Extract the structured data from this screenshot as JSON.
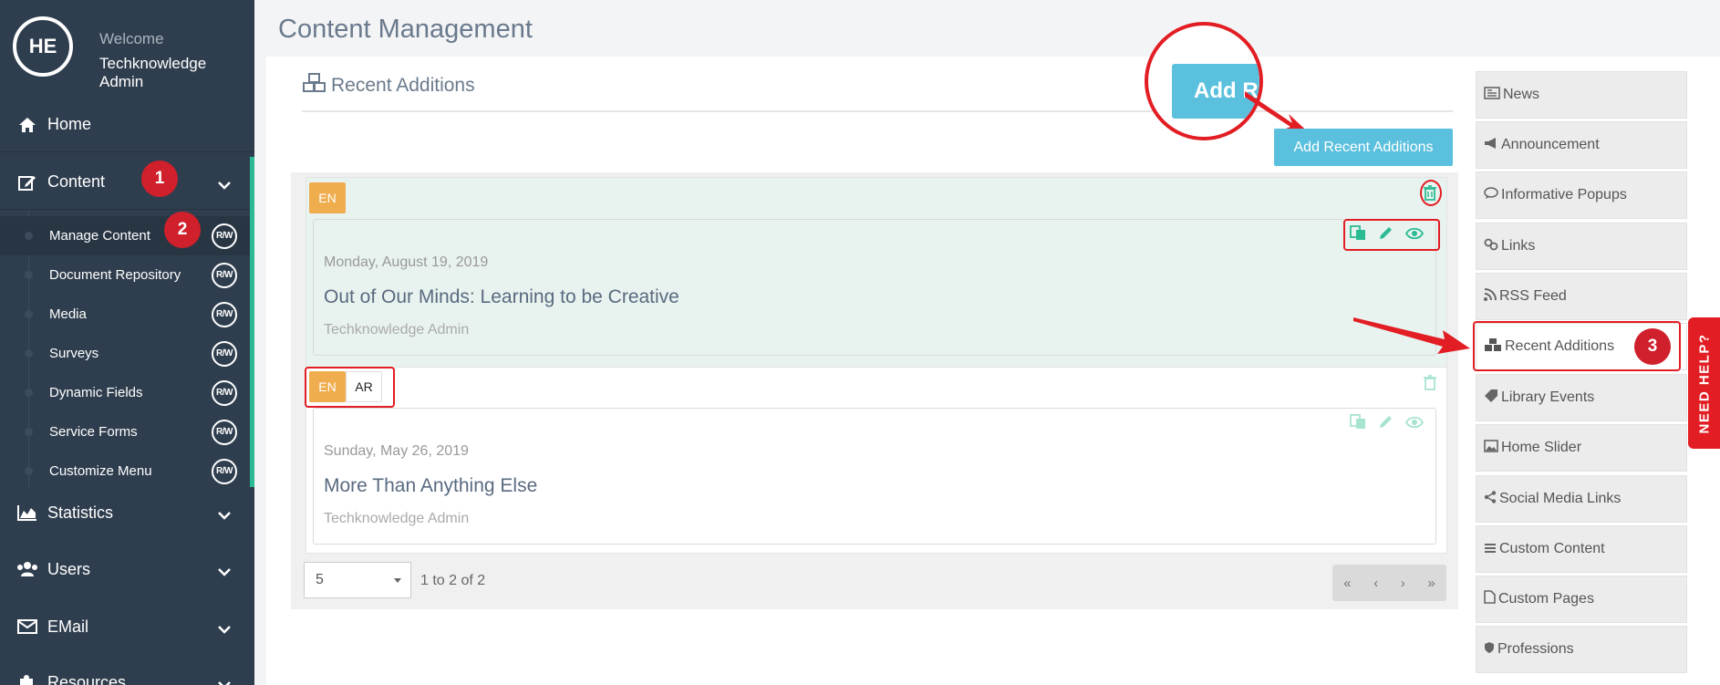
{
  "sidebar": {
    "avatar_initials": "HE",
    "welcome": "Welcome",
    "user_name": "Techknowledge Admin",
    "home": "Home",
    "content": "Content",
    "submenu": [
      {
        "label": "Manage Content",
        "rw": "R/W"
      },
      {
        "label": "Document Repository",
        "rw": "R/W"
      },
      {
        "label": "Media",
        "rw": "R/W"
      },
      {
        "label": "Surveys",
        "rw": "R/W"
      },
      {
        "label": "Dynamic Fields",
        "rw": "R/W"
      },
      {
        "label": "Service Forms",
        "rw": "R/W"
      },
      {
        "label": "Customize Menu",
        "rw": "R/W"
      }
    ],
    "statistics": "Statistics",
    "users": "Users",
    "email": "EMail",
    "resources": "Resources"
  },
  "annotations": {
    "step1": "1",
    "step2": "2",
    "step3": "3"
  },
  "main": {
    "page_title": "Content Management",
    "section_title": "Recent Additions",
    "add_button": "Add Recent Additions",
    "zoom_button_text": "Add Re"
  },
  "items": [
    {
      "langs": [
        "EN"
      ],
      "date": "Monday, August 19, 2019",
      "title": "Out of Our Minds: Learning to be Creative",
      "author": "Techknowledge Admin"
    },
    {
      "langs": [
        "EN",
        "AR"
      ],
      "date": "Sunday, May 26, 2019",
      "title": "More Than Anything Else",
      "author": "Techknowledge Admin"
    }
  ],
  "pager": {
    "page_size": "5",
    "info": "1 to 2 of 2",
    "first": "«",
    "prev": "‹",
    "next": "›",
    "last": "»"
  },
  "right_menu": [
    {
      "label": "News",
      "icon": "newspaper-icon"
    },
    {
      "label": "Announcement",
      "icon": "bullhorn-icon"
    },
    {
      "label": "Informative Popups",
      "icon": "comment-icon"
    },
    {
      "label": "Links",
      "icon": "link-icon"
    },
    {
      "label": "RSS Feed",
      "icon": "rss-icon"
    },
    {
      "label": "Recent Additions",
      "icon": "cubes-icon"
    },
    {
      "label": "Library Events",
      "icon": "tag-icon"
    },
    {
      "label": "Home Slider",
      "icon": "image-icon"
    },
    {
      "label": "Social Media Links",
      "icon": "share-icon"
    },
    {
      "label": "Custom Content",
      "icon": "stack-icon"
    },
    {
      "label": "Custom Pages",
      "icon": "file-icon"
    },
    {
      "label": "Professions",
      "icon": "shield-icon"
    }
  ],
  "help_tab": "NEED HELP?",
  "colors": {
    "sidebar_bg": "#2f3e4e",
    "accent_green": "#2bbb94",
    "button_blue": "#5bc0de",
    "lang_orange": "#f0ad4e",
    "annotation_red": "#e21d23"
  }
}
